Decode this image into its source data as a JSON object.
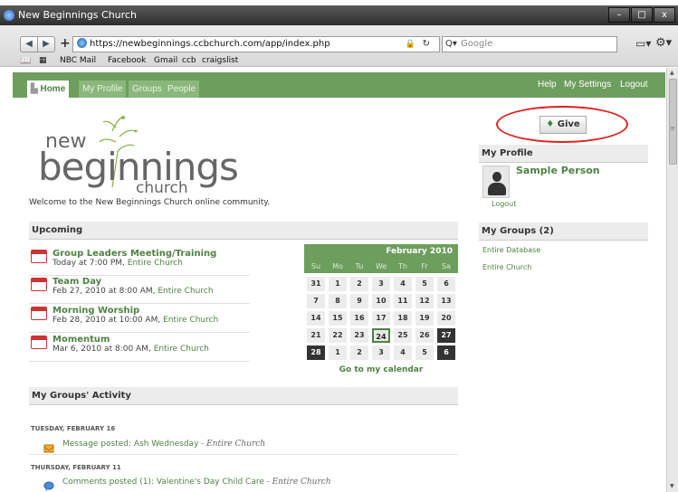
{
  "window": {
    "title": "New Beginnings Church",
    "min": "–",
    "max": "□",
    "close": "x"
  },
  "browser": {
    "url": "https://newbeginnings.ccbchurch.com/app/index.php",
    "search_placeholder": "Google",
    "bookmarks": [
      "NBC Mail",
      "Facebook",
      "Gmail",
      "ccb",
      "craigslist"
    ]
  },
  "nav": {
    "tabs": [
      "Home",
      "My Profile",
      "Groups",
      "People"
    ],
    "active_tab": "Home",
    "right_links": [
      "Help",
      "My Settings",
      "Logout"
    ]
  },
  "logo": {
    "line1": "new",
    "line2": "beginnings",
    "line3": "church"
  },
  "welcome": "Welcome to the New Beginnings Church online community.",
  "upcoming": {
    "heading": "Upcoming",
    "events": [
      {
        "title": "Group Leaders Meeting/Training",
        "when": "Today at 7:00 PM, ",
        "group": "Entire Church"
      },
      {
        "title": "Team Day",
        "when": "Feb 27, 2010 at 8:00 AM, ",
        "group": "Entire Church"
      },
      {
        "title": "Morning Worship",
        "when": "Feb 28, 2010 at 10:00 AM, ",
        "group": "Entire Church"
      },
      {
        "title": "Momentum",
        "when": "Mar 6, 2010 at 8:00 AM, ",
        "group": "Entire Church"
      }
    ]
  },
  "calendar": {
    "month": "February 2010",
    "days_of_week": [
      "Su",
      "Mo",
      "Tu",
      "We",
      "Th",
      "Fr",
      "Sa"
    ],
    "weeks": [
      [
        "31",
        "1",
        "2",
        "3",
        "4",
        "5",
        "6"
      ],
      [
        "7",
        "8",
        "9",
        "10",
        "11",
        "12",
        "13"
      ],
      [
        "14",
        "15",
        "16",
        "17",
        "18",
        "19",
        "20"
      ],
      [
        "21",
        "22",
        "23",
        "24",
        "25",
        "26",
        "27"
      ],
      [
        "28",
        "1",
        "2",
        "3",
        "4",
        "5",
        "6"
      ]
    ],
    "today": "24",
    "highlighted": [
      "27",
      "28",
      "6"
    ],
    "go_to": "Go to my calendar"
  },
  "activity": {
    "heading": "My Groups' Activity",
    "days": [
      {
        "label": "TUESDAY, FEBRUARY 16",
        "item": "Message posted: Ash Wednesday",
        "context": " - Entire Church"
      },
      {
        "label": "THURSDAY, FEBRUARY 11",
        "item": "Comments posted (1): Valentine's Day Child Care",
        "context": " - Entire Church"
      }
    ]
  },
  "give": {
    "label": "Give"
  },
  "profile": {
    "heading": "My Profile",
    "name": "Sample Person",
    "logout": "Logout"
  },
  "groups": {
    "heading": "My Groups (2)",
    "items": [
      "Entire Database",
      "Entire Church"
    ]
  }
}
